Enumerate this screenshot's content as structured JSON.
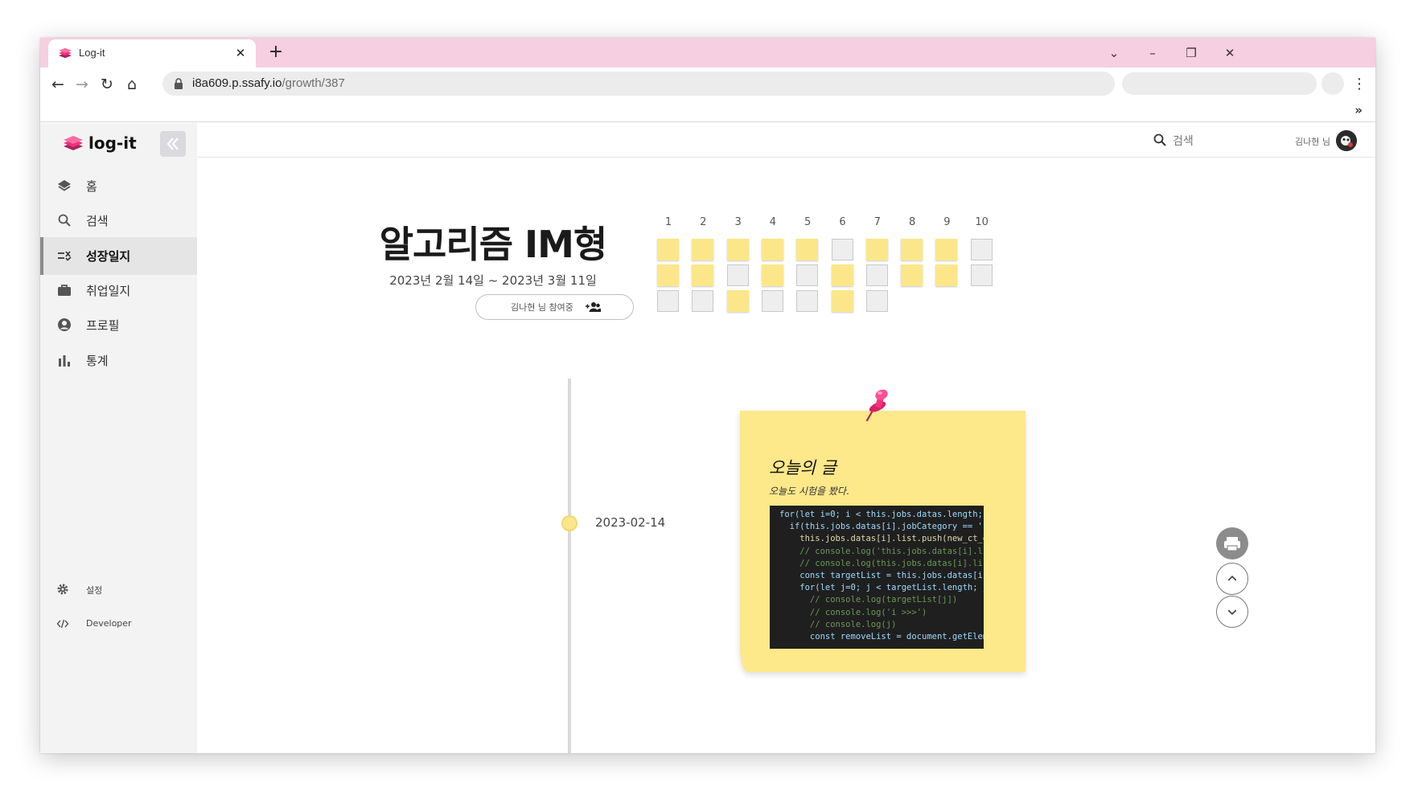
{
  "browser": {
    "tab_title": "Log-it",
    "url_host": "i8a609.p.ssafy.io",
    "url_path": "/growth/387",
    "overflow_label": "»"
  },
  "app": {
    "brand": "log-it",
    "nav": [
      {
        "label": "홈",
        "icon": "layers-icon"
      },
      {
        "label": "검색",
        "icon": "search-icon"
      },
      {
        "label": "성장일지",
        "icon": "checklist-icon",
        "active": true
      },
      {
        "label": "취업일지",
        "icon": "briefcase-icon"
      },
      {
        "label": "프로필",
        "icon": "user-circle-icon"
      },
      {
        "label": "통계",
        "icon": "bar-chart-icon"
      }
    ],
    "footer": [
      {
        "label": "설정",
        "icon": "gear-icon"
      },
      {
        "label": "Developer",
        "icon": "code-icon"
      }
    ],
    "search_placeholder": "검색",
    "user": "김나현 님"
  },
  "journal": {
    "title": "알고리즘 IM형",
    "period": "2023년 2월 14일 ~ 2023년 3월 11일",
    "participants": "김나현 님 참여중",
    "columns": [
      "1",
      "2",
      "3",
      "4",
      "5",
      "6",
      "7",
      "8",
      "9",
      "10"
    ],
    "completed": [
      [
        true,
        true,
        true,
        true,
        true,
        false,
        true,
        true,
        true,
        false
      ],
      [
        true,
        true,
        false,
        true,
        false,
        true,
        false,
        true,
        true,
        false
      ],
      [
        false,
        false,
        true,
        false,
        false,
        true,
        false
      ]
    ],
    "accent_color": "#fbe78a"
  },
  "timeline": {
    "date": "2023-02-14",
    "note_title": "오늘의 글",
    "note_text": "오늘도 시험을 봤다.",
    "code_lines": [
      "for(let i=0; i < this.jobs.datas.length; ",
      "  if(this.jobs.datas[i].jobCategory == '",
      "    this.jobs.datas[i].list.push(new_ct_d",
      "    // console.log('this.jobs.datas[i].li",
      "    // console.log(this.jobs.datas[i].lis",
      "    const targetList = this.jobs.datas[i]",
      "    for(let j=0; j < targetList.length; j",
      "      // console.log(targetList[j])",
      "      // console.log('i >>>')",
      "      // console.log(j)",
      "      const removeList = document.getElem"
    ]
  }
}
